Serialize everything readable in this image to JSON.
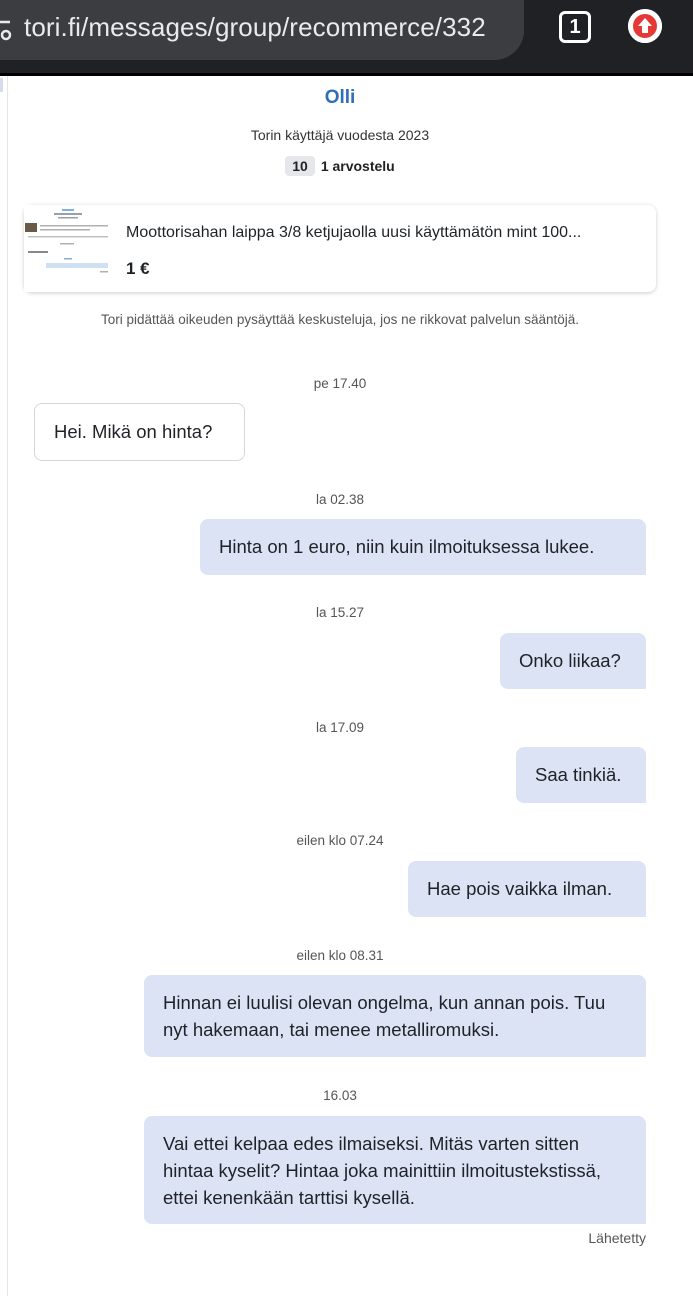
{
  "browser": {
    "url": "tori.fi/messages/group/recommerce/332",
    "tab_count": "1",
    "site_info_icon": "tune-icon",
    "upload_icon": "arrow-up-icon",
    "upload_color": "#e53935"
  },
  "seller": {
    "name": "Olli",
    "member_since": "Torin käyttäjä vuodesta 2023",
    "rating_score": "10",
    "reviews": "1 arvostelu"
  },
  "listing": {
    "title": "Moottorisahan laippa 3/8 ketjujaolla uusi käyttämätön mint 100...",
    "price": "1 €"
  },
  "notice": "Tori pidättää oikeuden pysäyttää keskusteluja, jos ne rikkovat palvelun sääntöjä.",
  "messages": [
    {
      "time": "pe 17.40",
      "direction": "incoming",
      "text": "Hei. Mikä on hinta?"
    },
    {
      "time": "la 02.38",
      "direction": "outgoing",
      "text": "Hinta on 1 euro, niin kuin ilmoituksessa lukee."
    },
    {
      "time": "la 15.27",
      "direction": "outgoing",
      "text": "Onko liikaa?"
    },
    {
      "time": "la 17.09",
      "direction": "outgoing",
      "text": "Saa tinkiä."
    },
    {
      "time": "eilen klo 07.24",
      "direction": "outgoing",
      "text": "Hae pois vaikka ilman."
    },
    {
      "time": "eilen klo 08.31",
      "direction": "outgoing",
      "text": "Hinnan ei luulisi olevan ongelma, kun annan pois. Tuu nyt hakemaan, tai menee metalliromuksi."
    },
    {
      "time": "16.03",
      "direction": "outgoing",
      "text": "Vai ettei kelpaa edes ilmaiseksi. Mitäs varten sitten hintaa kyselit? Hintaa joka mainittiin ilmoitustekstissä, ettei kenenkään tarttisi kysellä."
    }
  ],
  "status": "Lähetetty",
  "colors": {
    "accent": "#2f6fb7",
    "outgoing_bubble": "#dbe3f5",
    "browser_bar": "#202124"
  }
}
